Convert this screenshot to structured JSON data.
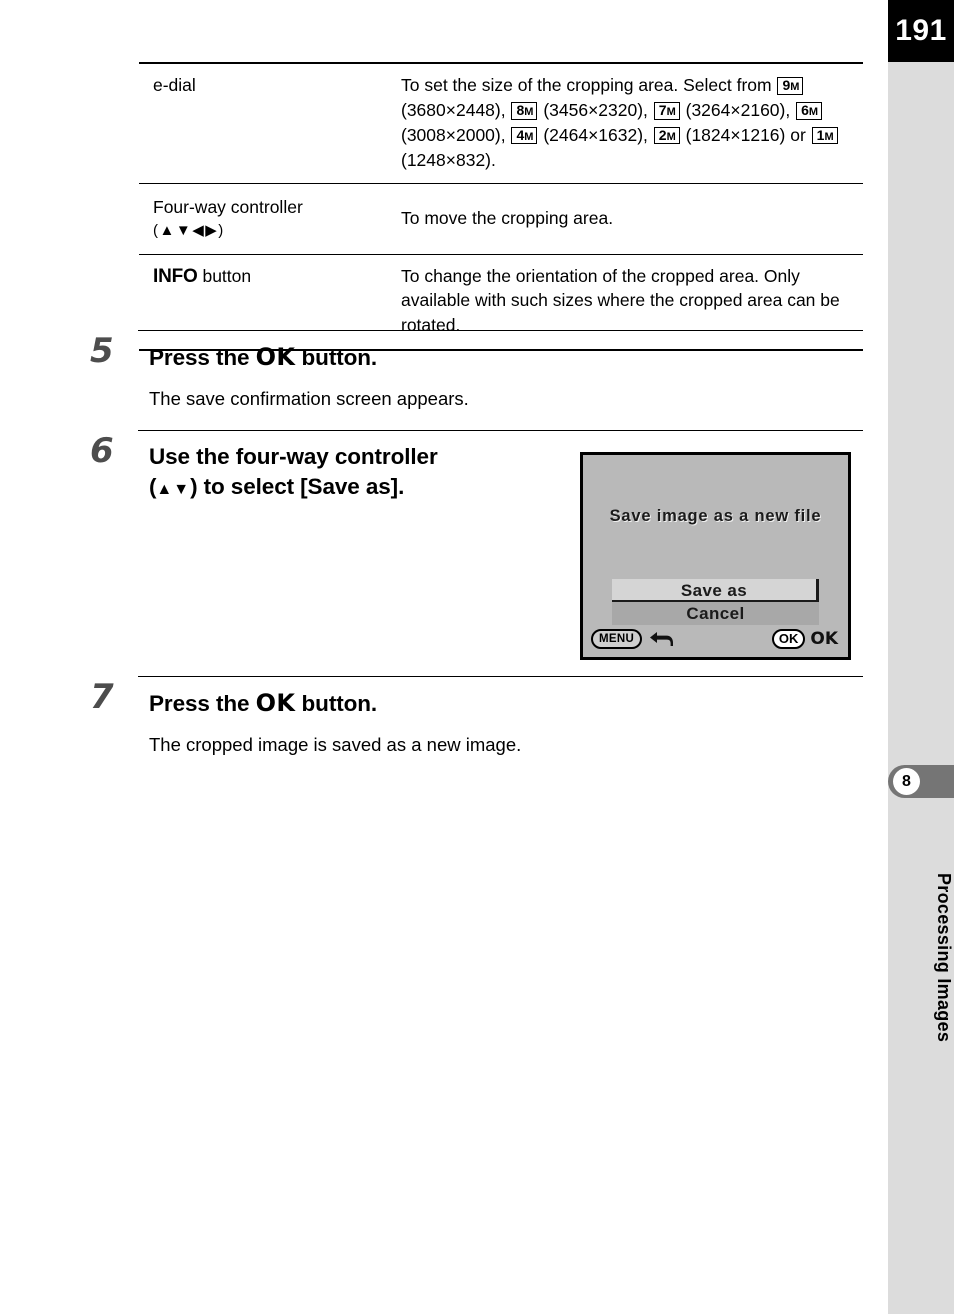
{
  "page": {
    "number": "191",
    "chapter_number": "8",
    "chapter_title": "Processing Images"
  },
  "spec_table": {
    "rows": [
      {
        "key": "e-dial",
        "key_style": "plain",
        "desc_prefix": "To set the size of the cropping area. Select from ",
        "sizes": [
          {
            "badge_num": "9",
            "badge_m": "M",
            "dims": "(3680×2448), "
          },
          {
            "badge_num": "8",
            "badge_m": "M",
            "dims": "(3456×2320), "
          },
          {
            "badge_num": "7",
            "badge_m": "M",
            "dims": "(3264×2160), "
          },
          {
            "badge_num": "6",
            "badge_m": "M",
            "dims": "(3008×2000), "
          },
          {
            "badge_num": "4",
            "badge_m": "M",
            "dims": "(2464×1632), "
          },
          {
            "badge_num": "2",
            "badge_m": "M",
            "dims": "(1824×1216) or "
          },
          {
            "badge_num": "1",
            "badge_m": "M",
            "dims": "(1248×832)."
          }
        ]
      },
      {
        "key": "Four-way controller",
        "key_sub": "(▲▼◀▶)",
        "desc": "To move the cropping area."
      },
      {
        "key_bold": "INFO",
        "key_rest": " button",
        "desc": "To change the orientation of the cropped area. Only available with such sizes where the cropped area can be rotated."
      }
    ]
  },
  "steps": [
    {
      "number": "5",
      "title_pre": "Press the ",
      "title_glyph": "OK",
      "title_post": " button.",
      "desc": "The save confirmation screen appears."
    },
    {
      "number": "6",
      "title_line1": "Use the four-way controller",
      "title_line2_pre": "(",
      "title_line2_arrows": "▲▼",
      "title_line2_post": ") to select [Save as].",
      "desc": ""
    },
    {
      "number": "7",
      "title_pre": "Press the ",
      "title_glyph": "OK",
      "title_post": " button.",
      "desc": "The cropped image is saved as a new image."
    }
  ],
  "lcd_screen": {
    "title": "Save image as a new file",
    "items": [
      {
        "label": "Save as",
        "selected": true
      },
      {
        "label": "Cancel",
        "selected": false
      }
    ],
    "footer": {
      "menu_label": "MENU",
      "menu_icon": "back-arrow-icon",
      "ok_badge": "OK",
      "ok_label": "OK"
    }
  },
  "colors": {
    "rail_background": "#dcdcdc",
    "chapter_tab": "#757575",
    "page_number_box": "#000000",
    "lcd_background": "#b9b9b9",
    "lcd_selected": "#d5d5d5",
    "lcd_unselected": "#a8a8a8",
    "step_number": "#4d4d4d"
  }
}
